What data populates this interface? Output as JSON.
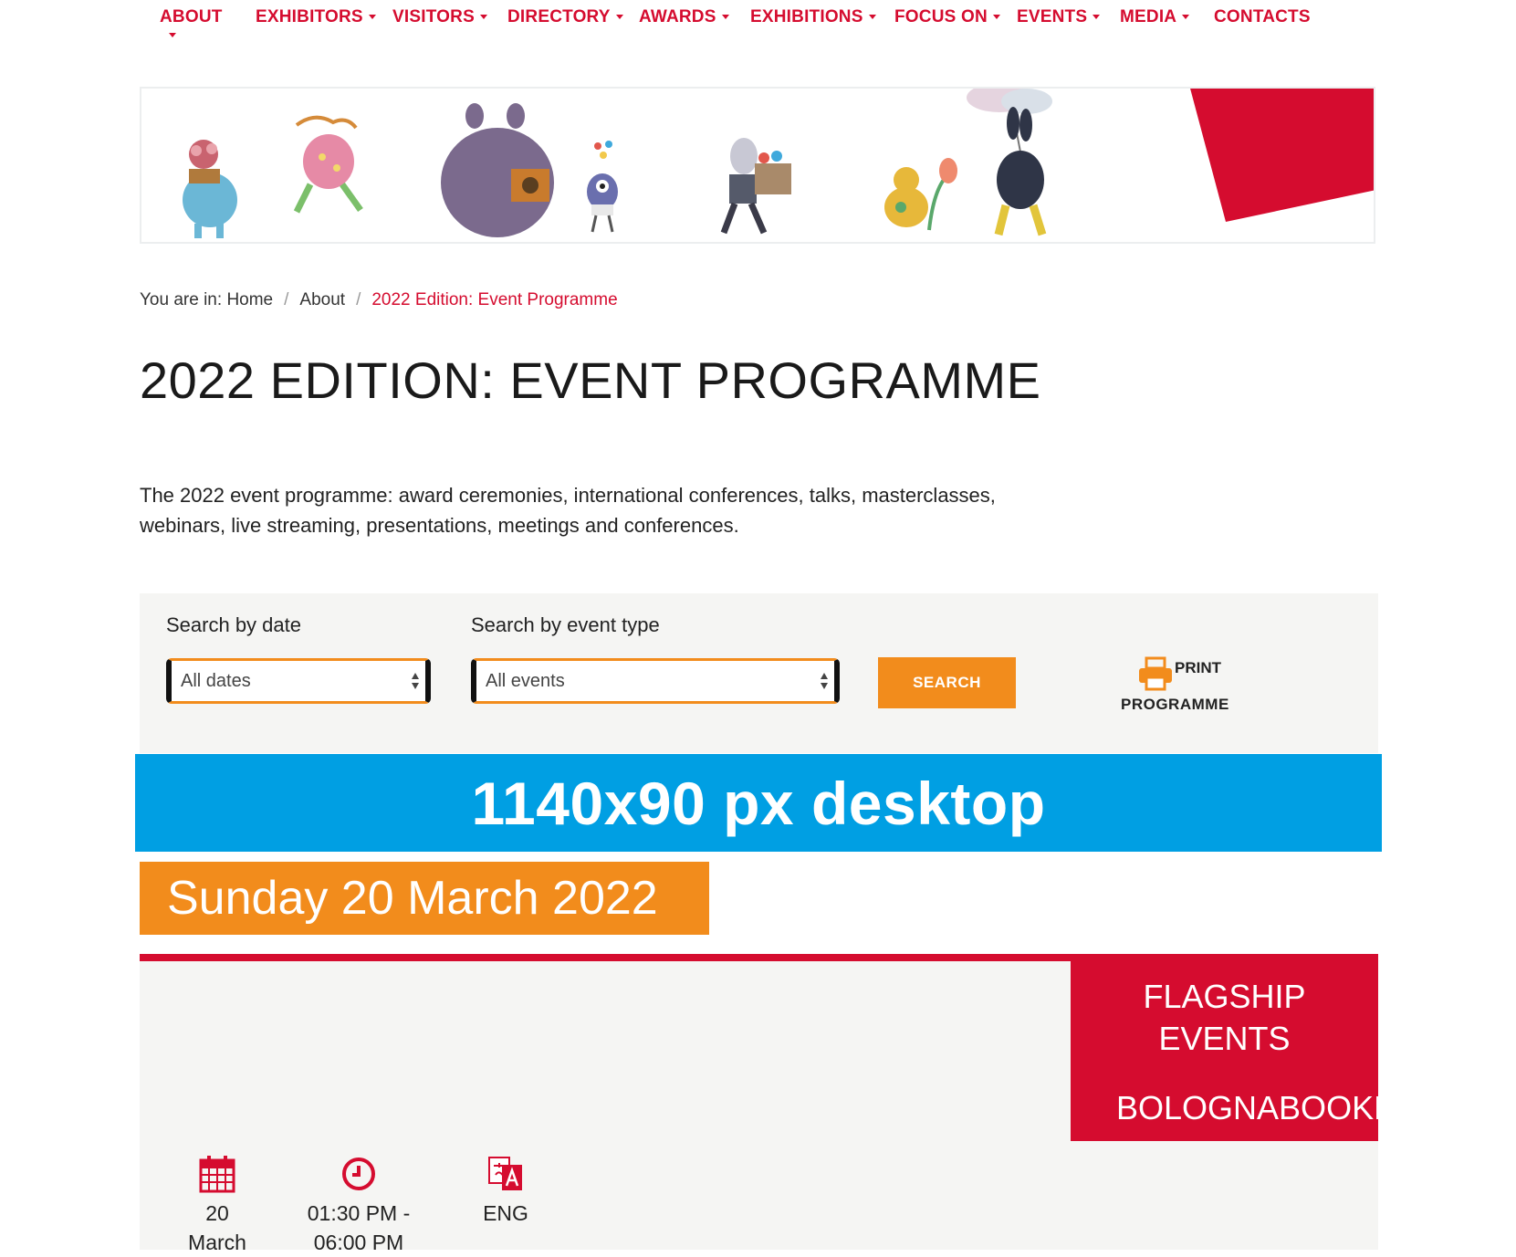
{
  "nav": {
    "items": [
      {
        "label": "ABOUT",
        "caret": "below"
      },
      {
        "label": "EXHIBITORS",
        "caret": "right"
      },
      {
        "label": "VISITORS",
        "caret": "right"
      },
      {
        "label": "DIRECTORY",
        "caret": "right"
      },
      {
        "label": "AWARDS",
        "caret": "right"
      },
      {
        "label": "EXHIBITIONS",
        "caret": "right"
      },
      {
        "label": "FOCUS ON",
        "caret": "right"
      },
      {
        "label": "EVENTS",
        "caret": "right"
      },
      {
        "label": "MEDIA",
        "caret": "right"
      },
      {
        "label": "CONTACTS",
        "caret": "none"
      }
    ]
  },
  "breadcrumb": {
    "prefix": "You are in:",
    "home": "Home",
    "separator": "/",
    "about": "About",
    "current": "2022 Edition: Event Programme"
  },
  "page": {
    "title": "2022 EDITION: EVENT PROGRAMME",
    "intro": "The 2022 event programme: award ceremonies, international conferences, talks, masterclasses, webinars, live streaming, presentations, meetings and conferences."
  },
  "filters": {
    "date_label": "Search by date",
    "date_value": "All dates",
    "type_label": "Search by event type",
    "type_value": "All events",
    "search_button": "SEARCH",
    "print_top": "PRINT",
    "print_bottom": "PROGRAMME"
  },
  "ad": {
    "text": "1140x90 px desktop"
  },
  "day": {
    "heading": "Sunday 20 March 2022"
  },
  "event": {
    "category_line1": "FLAGSHIP",
    "category_line2": "EVENTS",
    "organizer": "BOLOGNABOOKP",
    "date_day": "20",
    "date_month": "March",
    "time_start": "01:30 PM -",
    "time_end": "06:00 PM",
    "language": "ENG",
    "icons": [
      "calendar-icon",
      "clock-icon",
      "translate-icon",
      "printer-icon"
    ]
  },
  "colors": {
    "brand_red": "#d50c2f",
    "accent_orange": "#f28c1c",
    "ad_blue": "#009fe3",
    "panel_grey": "#f5f5f3"
  }
}
